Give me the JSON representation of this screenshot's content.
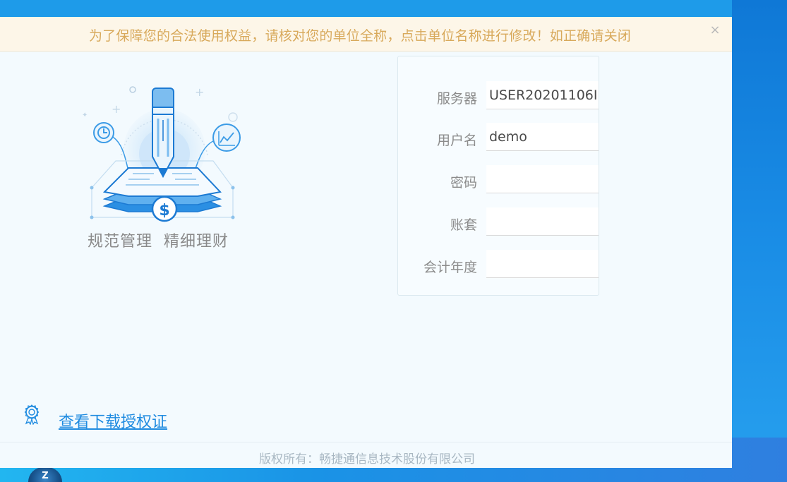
{
  "notice": {
    "text": "为了保障您的合法使用权益，请核对您的单位全称，点击单位名称进行修改！如正确请关闭",
    "close_symbol": "×"
  },
  "illustration": {
    "icon": "pencil-document-finance-illustration",
    "tagline_left": "规范管理",
    "tagline_right": "精细理财"
  },
  "login": {
    "server_label": "服务器",
    "server_value": "USER20201106I",
    "user_label": "用户名",
    "user_value": "demo",
    "password_label": "密码",
    "password_value": "",
    "account_set_label": "账套",
    "account_set_value": "",
    "fiscal_year_label": "会计年度",
    "fiscal_year_value": ""
  },
  "license": {
    "icon": "certificate-icon",
    "link_text": "查看下载授权证"
  },
  "footer": {
    "copyright": "版权所有：畅捷通信息技术股份有限公司"
  },
  "colors": {
    "accent": "#1f8be0",
    "notice_text": "#d8a95b",
    "notice_bg": "#fdf6e8"
  }
}
